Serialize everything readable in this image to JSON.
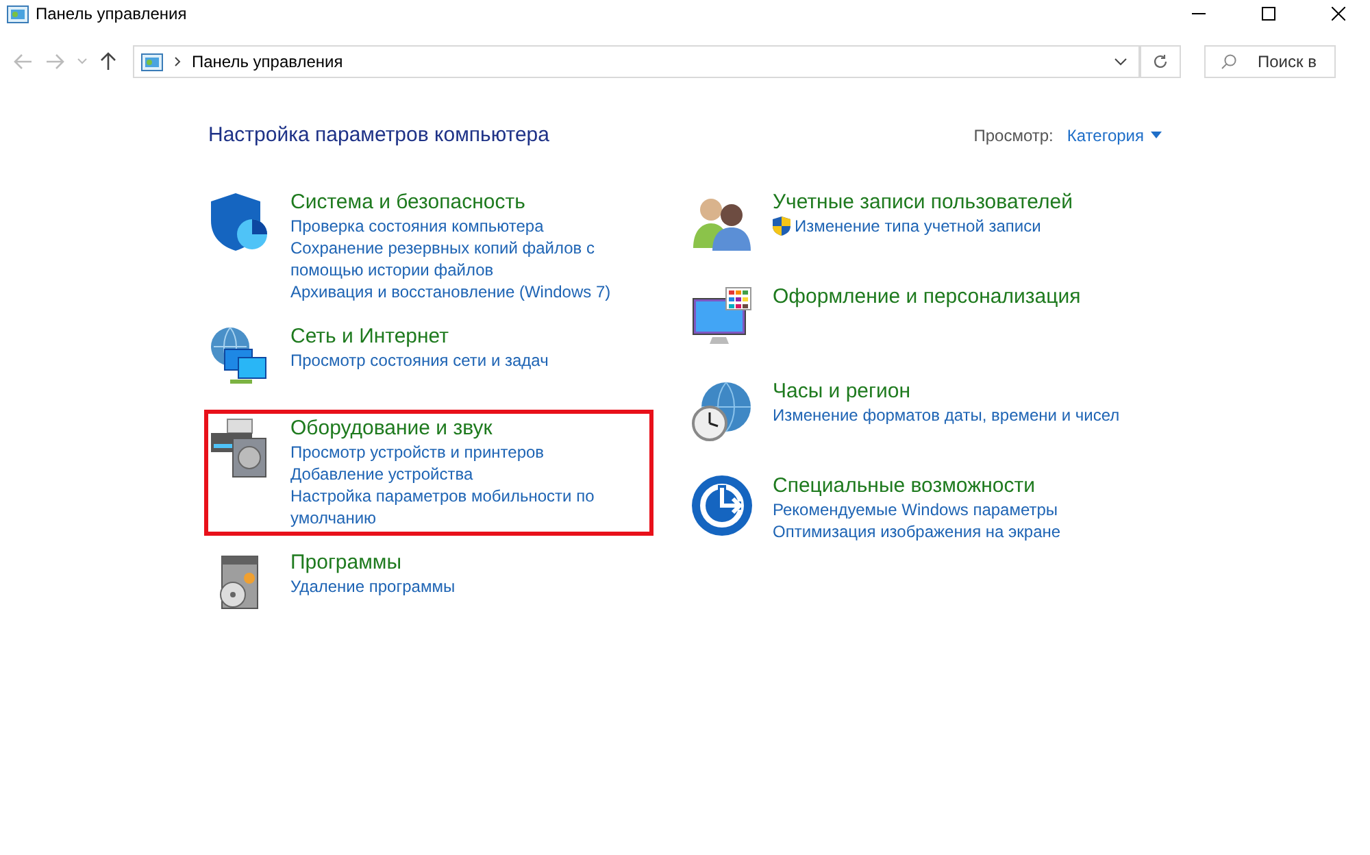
{
  "window": {
    "title": "Панель управления"
  },
  "address_bar": {
    "path": "Панель управления"
  },
  "search": {
    "placeholder": "Поиск в"
  },
  "heading": "Настройка параметров компьютера",
  "view": {
    "label": "Просмотр:",
    "value": "Категория"
  },
  "columns": [
    [
      {
        "kind": "security",
        "title": "Система и безопасность",
        "highlighted": false,
        "links": [
          {
            "text": "Проверка состояния компьютера",
            "shield": false
          },
          {
            "text": "Сохранение резервных копий файлов с помощью истории файлов",
            "shield": false
          },
          {
            "text": "Архивация и восстановление (Windows 7)",
            "shield": false
          }
        ]
      },
      {
        "kind": "network",
        "title": "Сеть и Интернет",
        "highlighted": false,
        "links": [
          {
            "text": "Просмотр состояния сети и задач",
            "shield": false
          }
        ]
      },
      {
        "kind": "hardware",
        "title": "Оборудование и звук",
        "highlighted": true,
        "links": [
          {
            "text": "Просмотр устройств и принтеров",
            "shield": false
          },
          {
            "text": "Добавление устройства",
            "shield": false
          },
          {
            "text": "Настройка параметров мобильности по умолчанию",
            "shield": false
          }
        ]
      },
      {
        "kind": "programs",
        "title": "Программы",
        "highlighted": false,
        "links": [
          {
            "text": "Удаление программы",
            "shield": false
          }
        ]
      }
    ],
    [
      {
        "kind": "users",
        "title": "Учетные записи пользователей",
        "highlighted": false,
        "links": [
          {
            "text": "Изменение типа учетной записи",
            "shield": true
          }
        ]
      },
      {
        "kind": "appearance",
        "title": "Оформление и персонализация",
        "highlighted": false
      },
      {
        "kind": "clock",
        "title": "Часы и регион",
        "highlighted": false,
        "links": [
          {
            "text": "Изменение форматов даты, времени и чисел",
            "shield": false
          }
        ]
      },
      {
        "kind": "access",
        "title": "Специальные возможности",
        "highlighted": false,
        "links": [
          {
            "text": "Рекомендуемые Windows параметры",
            "shield": false
          },
          {
            "text": "Оптимизация изображения на экране",
            "shield": false
          }
        ]
      }
    ]
  ]
}
